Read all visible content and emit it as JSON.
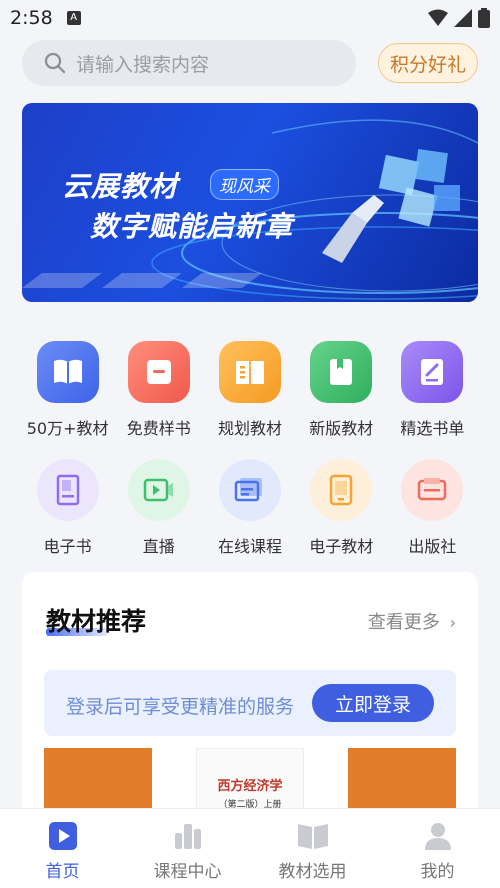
{
  "status_bar": {
    "time": "2:58",
    "notification_icon": "A"
  },
  "search": {
    "placeholder": "请输入搜索内容"
  },
  "points_button": "积分好礼",
  "banner": {
    "line1": "云展教材",
    "tag": "现风采",
    "line2": "数字赋能启新章"
  },
  "quick_links_row1": [
    {
      "label": "50万+教材",
      "icon": "book-open-icon",
      "color": "#4a72f0"
    },
    {
      "label": "免费样书",
      "icon": "sample-book-icon",
      "color": "#f26b5a"
    },
    {
      "label": "规划教材",
      "icon": "plan-book-icon",
      "color": "#f5a432"
    },
    {
      "label": "新版教材",
      "icon": "new-book-icon",
      "color": "#3dbf6b"
    },
    {
      "label": "精选书单",
      "icon": "booklist-icon",
      "color": "#8f6cf0"
    }
  ],
  "quick_links_row2": [
    {
      "label": "电子书",
      "icon": "ebook-icon",
      "color": "#8f6cf0"
    },
    {
      "label": "直播",
      "icon": "live-icon",
      "color": "#3dbf6b"
    },
    {
      "label": "在线课程",
      "icon": "online-course-icon",
      "color": "#4a72f0"
    },
    {
      "label": "电子教材",
      "icon": "e-textbook-icon",
      "color": "#f5a432"
    },
    {
      "label": "出版社",
      "icon": "publisher-icon",
      "color": "#f26b5a"
    }
  ],
  "recommend": {
    "title": "教材推荐",
    "more": "查看更多",
    "login_prompt": "登录后可享受更精准的服务",
    "login_button": "立即登录",
    "book2_title": "西方经济学",
    "book2_sub": "（第二版）上册"
  },
  "tabs": [
    {
      "label": "首页",
      "icon": "home-play-icon",
      "active": true
    },
    {
      "label": "课程中心",
      "icon": "course-chart-icon",
      "active": false
    },
    {
      "label": "教材选用",
      "icon": "textbook-icon",
      "active": false
    },
    {
      "label": "我的",
      "icon": "user-icon",
      "active": false
    }
  ]
}
